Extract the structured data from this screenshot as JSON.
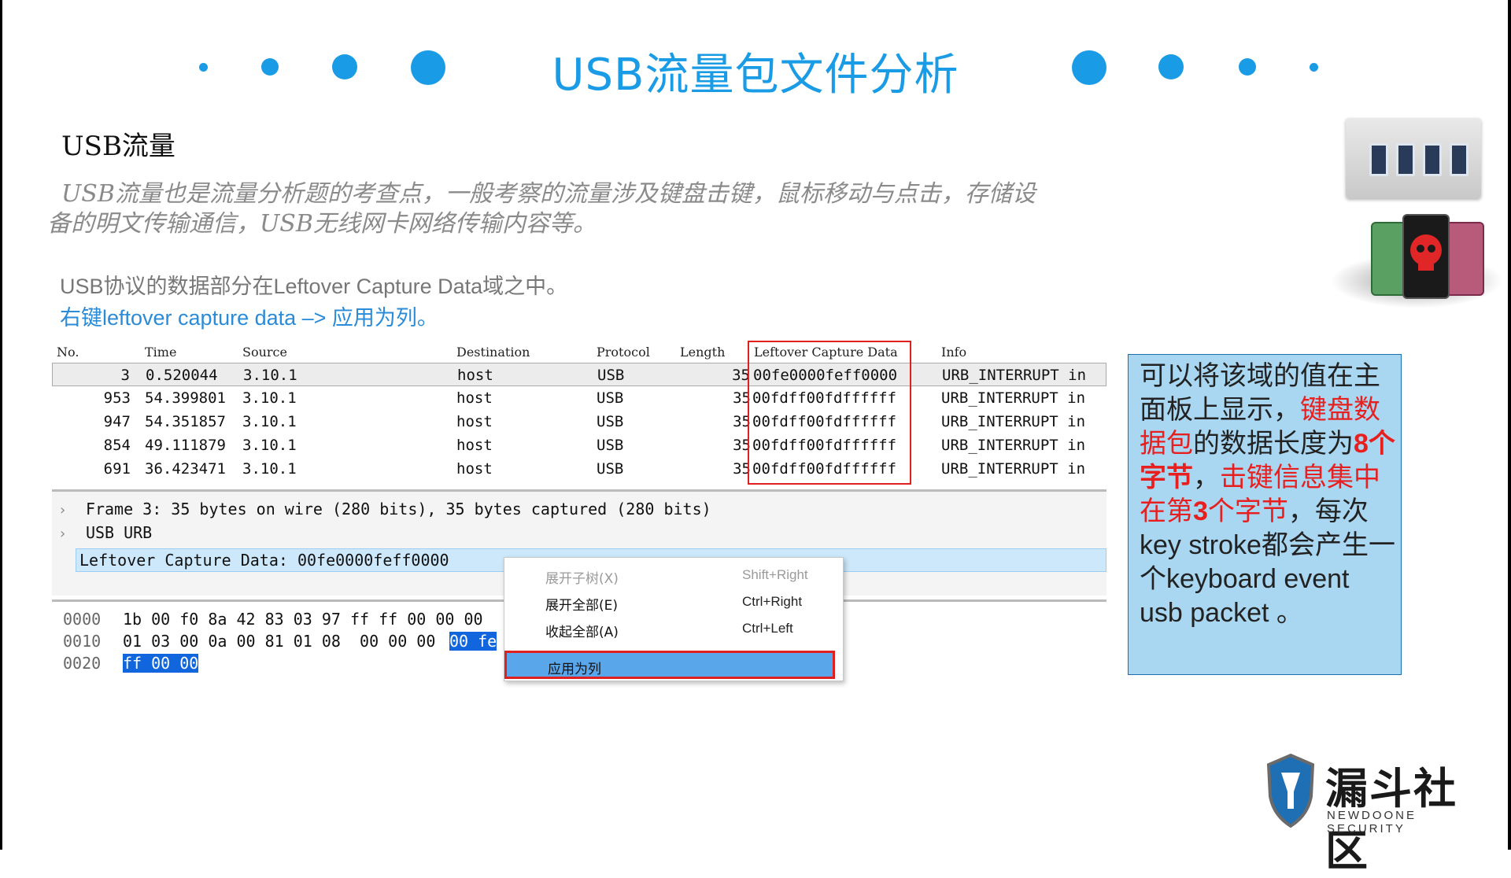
{
  "slide": {
    "title": "USB流量包文件分析",
    "section_title": "USB流量",
    "intro": "USB流量也是流量分析题的考查点，一般考察的流量涉及键盘击键，鼠标移动与点击，存储设备的明文传输通信，USB无线网卡网络传输内容等。",
    "note_line1": "USB协议的数据部分在Leftover Capture Data域之中。",
    "note_line2": "右键leftover capture data –> 应用为列。"
  },
  "packet_list": {
    "headers": {
      "no": "No.",
      "time": "Time",
      "source": "Source",
      "destination": "Destination",
      "protocol": "Protocol",
      "length": "Length",
      "leftover": "Leftover Capture Data",
      "info": "Info"
    },
    "rows": [
      {
        "no": "3",
        "time": "0.520044",
        "source": "3.10.1",
        "destination": "host",
        "protocol": "USB",
        "length": "35",
        "leftover": "00fe0000feff0000",
        "info": "URB_INTERRUPT in"
      },
      {
        "no": "953",
        "time": "54.399801",
        "source": "3.10.1",
        "destination": "host",
        "protocol": "USB",
        "length": "35",
        "leftover": "00fdff00fdffffff",
        "info": "URB_INTERRUPT in"
      },
      {
        "no": "947",
        "time": "54.351857",
        "source": "3.10.1",
        "destination": "host",
        "protocol": "USB",
        "length": "35",
        "leftover": "00fdff00fdffffff",
        "info": "URB_INTERRUPT in"
      },
      {
        "no": "854",
        "time": "49.111879",
        "source": "3.10.1",
        "destination": "host",
        "protocol": "USB",
        "length": "35",
        "leftover": "00fdff00fdffffff",
        "info": "URB_INTERRUPT in"
      },
      {
        "no": "691",
        "time": "36.423471",
        "source": "3.10.1",
        "destination": "host",
        "protocol": "USB",
        "length": "35",
        "leftover": "00fdff00fdffffff",
        "info": "URB_INTERRUPT in"
      }
    ]
  },
  "details": {
    "frame": "Frame 3: 35 bytes on wire (280 bits), 35 bytes captured (280 bits)",
    "usb_urb": "USB URB",
    "leftover": "Leftover Capture Data: 00fe0000feff0000",
    "chevron": "›"
  },
  "hex": {
    "rows": [
      {
        "offset": "0000",
        "bytes": "1b 00 f0 8a 42 83 03 97  ff ff 00 00 00",
        "selected": ""
      },
      {
        "offset": "0010",
        "bytes": "01 03 00 0a 00 81 01 08  00 00 00 ",
        "selected": "00 fe"
      },
      {
        "offset": "0020",
        "bytes": "",
        "selected": "ff 00 00"
      }
    ]
  },
  "context_menu": {
    "items": [
      {
        "label": "展开子树(X)",
        "shortcut": "Shift+Right",
        "disabled": true
      },
      {
        "label": "展开全部(E)",
        "shortcut": "Ctrl+Right",
        "disabled": false
      },
      {
        "label": "收起全部(A)",
        "shortcut": "Ctrl+Left",
        "disabled": false
      }
    ],
    "apply_label": "应用为列"
  },
  "info_box": {
    "p1": "可以将该域的值在主面板上显示，",
    "p2": "键盘数据包",
    "p3": "的数据长度为",
    "p4": "8个字节",
    "p5": "，",
    "p6": "击键信息集中在第",
    "p7": "3",
    "p8": "个字节",
    "p9": "，每次key stroke都会产生一个keyboard event usb packet 。"
  },
  "logo": {
    "name": "漏斗社区",
    "sub": "NEWDOONE SECURITY"
  },
  "colors": {
    "accent_blue": "#1a9be6",
    "highlight_red": "#e02020",
    "info_box_bg": "#a9d7f2"
  }
}
